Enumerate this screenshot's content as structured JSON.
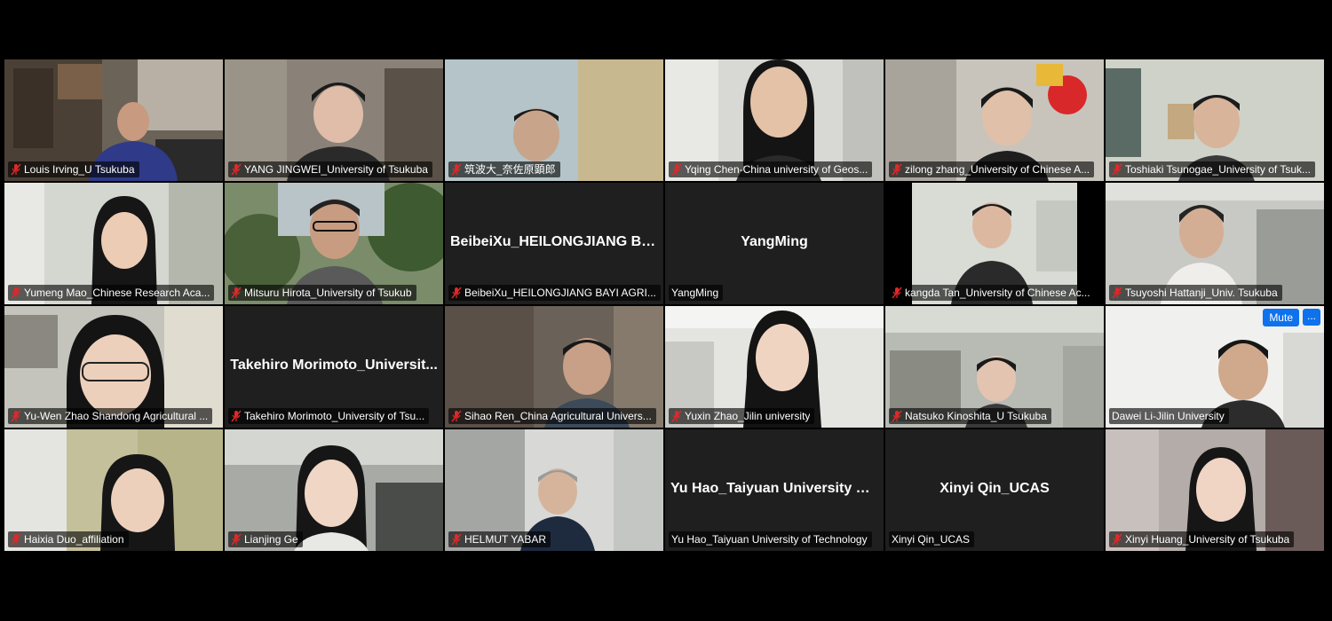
{
  "participants": [
    {
      "name": "Louis Irving_U Tsukuba",
      "muted": true
    },
    {
      "name": "YANG JINGWEI_University of Tsukuba",
      "muted": true
    },
    {
      "name": "筑波大_奈佐原顕郎",
      "muted": true
    },
    {
      "name": "Yqing Chen-China university of Geos...",
      "muted": true
    },
    {
      "name": "zilong zhang_University of Chinese A...",
      "muted": true
    },
    {
      "name": "Toshiaki Tsunogae_University of Tsuk...",
      "muted": true
    },
    {
      "name": "Yumeng Mao_Chinese Research Aca...",
      "muted": true
    },
    {
      "name": "Mitsuru Hirota_University of Tsukub",
      "muted": true
    },
    {
      "name": "BeibeiXu_HEILONGJIANG BAYI AGRI...",
      "muted": true,
      "display_name": "BeibeiXu_HEILONGJIANG BA..."
    },
    {
      "name": "YangMing",
      "muted": false,
      "display_name": "YangMing"
    },
    {
      "name": "kangda Tan_University of Chinese Ac...",
      "muted": true
    },
    {
      "name": "Tsuyoshi Hattanji_Univ. Tsukuba",
      "muted": true
    },
    {
      "name": "Yu-Wen Zhao Shandong Agricultural ...",
      "muted": true
    },
    {
      "name": "Takehiro Morimoto_University of Tsu...",
      "muted": true,
      "display_name": "Takehiro Morimoto_Universit..."
    },
    {
      "name": "Sihao Ren_China Agricultural Univers...",
      "muted": true
    },
    {
      "name": "Yuxin Zhao_Jilin university",
      "muted": true
    },
    {
      "name": "Natsuko Kinoshita_U Tsukuba",
      "muted": true
    },
    {
      "name": "Dawei Li-Jilin University",
      "muted": false,
      "hover_controls": {
        "mute": "Mute",
        "more": "..."
      }
    },
    {
      "name": "Haixia Duo_affiliation",
      "muted": true
    },
    {
      "name": "Lianjing Ge",
      "muted": true
    },
    {
      "name": "HELMUT YABAR",
      "muted": true
    },
    {
      "name": "Yu Hao_Taiyuan University of Technology",
      "muted": false,
      "display_name": "Yu Hao_Taiyuan University of..."
    },
    {
      "name": "Xinyi Qin_UCAS",
      "muted": false,
      "display_name": "Xinyi Qin_UCAS"
    },
    {
      "name": "Xinyi Huang_University of Tsukuba",
      "muted": true
    }
  ],
  "colors": {
    "background": "#000000",
    "muted_icon": "#e02828",
    "button": "#0e72ed"
  },
  "icons": {
    "muted": "microphone-muted-icon"
  }
}
